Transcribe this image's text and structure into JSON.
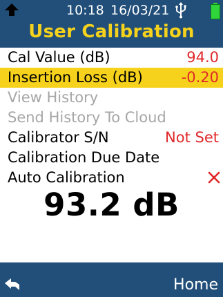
{
  "status": {
    "time": "10:18",
    "date": "16/03/21",
    "icons": [
      "up-arrow-icon",
      "usb-icon",
      "battery-icon"
    ]
  },
  "title": "User Calibration",
  "menu": [
    {
      "label": "Cal Value (dB)",
      "value": "94.0"
    },
    {
      "label": "Insertion Loss (dB)",
      "value": "-0.20"
    },
    {
      "label": "View History"
    },
    {
      "label": "Send History To Cloud"
    },
    {
      "label": "Calibrator S/N",
      "value": "Not Set"
    },
    {
      "label": "Calibration Due Date"
    },
    {
      "label": "Auto Calibration",
      "icon": "close-x-icon"
    }
  ],
  "reading": "93.2 dB",
  "footer": {
    "back_icon": "back-arrow-icon",
    "home_label": "Home"
  },
  "colors": {
    "header_bg": "#214f79",
    "title": "#f6d21c",
    "highlight": "#f6d21c",
    "value": "#e0282a",
    "disabled": "#a6a6a6",
    "battery": "#2fd53a"
  }
}
